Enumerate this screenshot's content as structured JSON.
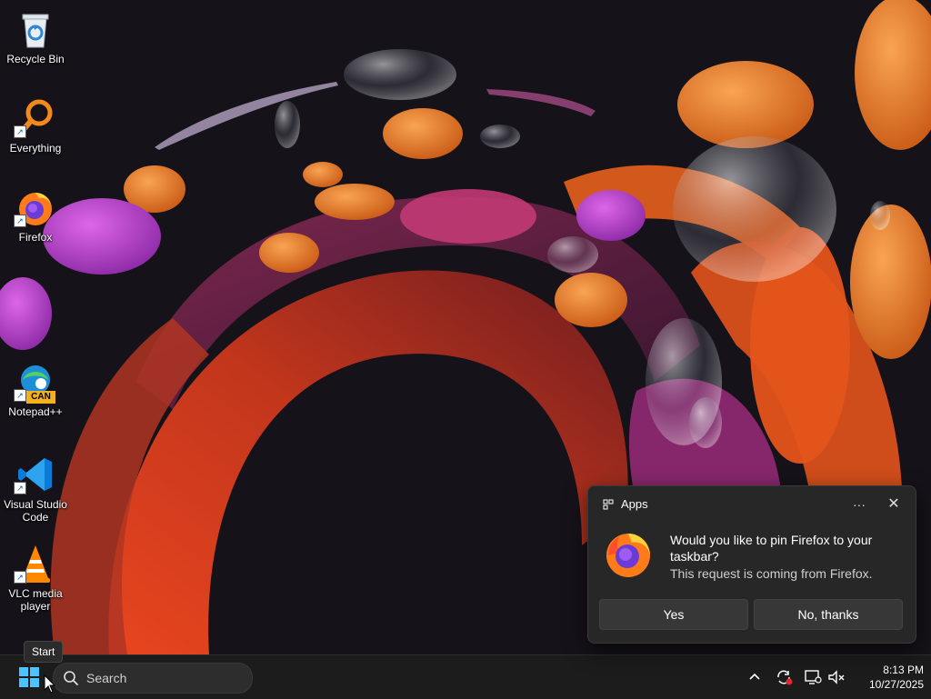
{
  "desktop": {
    "icons": [
      {
        "label": "Recycle Bin",
        "icon": "recycle-bin-icon"
      },
      {
        "label": "Everything",
        "icon": "everything-search-icon"
      },
      {
        "label": "Firefox",
        "icon": "firefox-icon"
      },
      {
        "label": "Notepad++",
        "icon": "notepad-plus-plus-icon",
        "badge": "CAN"
      },
      {
        "label": "Visual Studio Code",
        "icon": "vscode-icon"
      },
      {
        "label": "VLC media player",
        "icon": "vlc-icon"
      }
    ]
  },
  "tooltip": {
    "text": "Start"
  },
  "toast": {
    "app_name": "Apps",
    "more_glyph": "···",
    "close_glyph": "✕",
    "title": "Would you like to pin Firefox to your taskbar?",
    "subtitle": "This request is coming from Firefox.",
    "yes_label": "Yes",
    "no_label": "No, thanks"
  },
  "taskbar": {
    "search_placeholder": "Search",
    "tray_chevron": "^",
    "time": "8:13 PM",
    "date": "10/27/2025"
  },
  "colors": {
    "accent": "#0078d4",
    "taskbar_bg": "#1c1c1c",
    "toast_bg": "#272727"
  }
}
